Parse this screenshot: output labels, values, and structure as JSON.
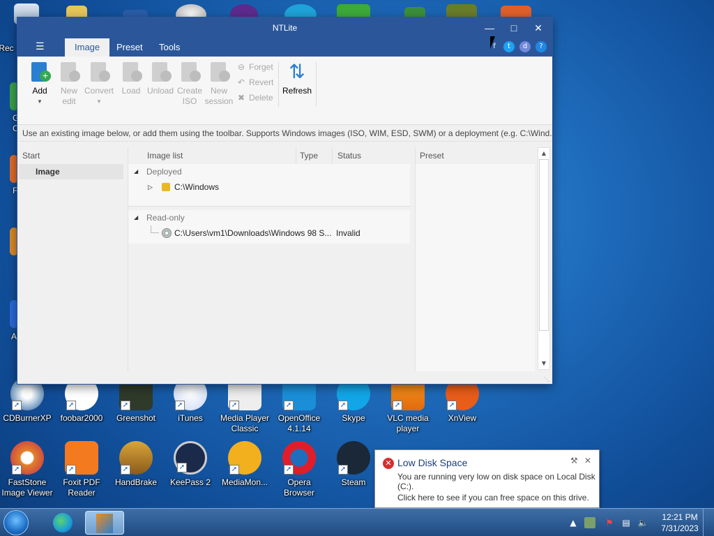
{
  "desktop": {
    "top_row_partial_labels": [
      "Rec"
    ],
    "left_partial_letters": [
      "G",
      "C",
      "F",
      "A"
    ],
    "icons_row1": [
      {
        "label": "CDBurnerXP",
        "icon": "cdburnerxp-icon"
      },
      {
        "label": "foobar2000",
        "icon": "foobar2000-icon"
      },
      {
        "label": "Greenshot",
        "icon": "greenshot-icon"
      },
      {
        "label": "iTunes",
        "icon": "itunes-icon"
      },
      {
        "label": "Media Player Classic",
        "icon": "media-player-classic-icon"
      },
      {
        "label": "OpenOffice 4.1.14",
        "icon": "openoffice-icon"
      },
      {
        "label": "Skype",
        "icon": "skype-icon"
      },
      {
        "label": "VLC media player",
        "icon": "vlc-icon"
      },
      {
        "label": "XnView",
        "icon": "xnview-icon"
      }
    ],
    "icons_row2": [
      {
        "label": "FastStone Image Viewer",
        "icon": "faststone-icon"
      },
      {
        "label": "Foxit PDF Reader",
        "icon": "foxit-icon"
      },
      {
        "label": "HandBrake",
        "icon": "handbrake-icon"
      },
      {
        "label": "KeePass 2",
        "icon": "keepass-icon"
      },
      {
        "label": "MediaMon...",
        "icon": "mediamonkey-icon"
      },
      {
        "label": "Opera Browser",
        "icon": "opera-icon"
      },
      {
        "label": "Steam",
        "icon": "steam-icon"
      }
    ]
  },
  "window": {
    "title": "NTLite",
    "tabs": [
      "Image",
      "Preset",
      "Tools"
    ],
    "active_tab": "Image",
    "ribbon": {
      "buttons": [
        {
          "label": "Add",
          "enabled": true,
          "icon": "add-image-icon"
        },
        {
          "label": "New edit",
          "enabled": false,
          "icon": "new-edit-icon"
        },
        {
          "label": "Convert",
          "enabled": false,
          "icon": "convert-icon"
        },
        {
          "label": "Load",
          "enabled": false,
          "icon": "load-icon"
        },
        {
          "label": "Unload",
          "enabled": false,
          "icon": "unload-icon"
        },
        {
          "label": "Create ISO",
          "enabled": false,
          "icon": "create-iso-icon"
        },
        {
          "label": "New session",
          "enabled": false,
          "icon": "new-session-icon"
        }
      ],
      "small_buttons": [
        {
          "label": "Forget",
          "icon": "forget-icon"
        },
        {
          "label": "Revert",
          "icon": "revert-icon"
        },
        {
          "label": "Delete",
          "icon": "delete-icon"
        }
      ],
      "refresh_label": "Refresh"
    },
    "info_text": "Use an existing image below, or add them using the toolbar. Supports Windows images (ISO, WIM, ESD, SWM) or a deployment (e.g. C:\\Wind...",
    "start_pane": {
      "header": "Start",
      "item": "Image"
    },
    "list": {
      "columns": [
        "Image list",
        "Type",
        "Status"
      ],
      "groups": [
        {
          "name": "Deployed",
          "rows": [
            {
              "path": "C:\\Windows",
              "type": "",
              "status": ""
            }
          ]
        },
        {
          "name": "Read-only",
          "rows": [
            {
              "path": "C:\\Users\\vm1\\Downloads\\Windows 98 S...",
              "type": "",
              "status": "Invalid"
            }
          ]
        }
      ]
    },
    "preset_pane": {
      "header": "Preset"
    }
  },
  "notification": {
    "title": "Low Disk Space",
    "line1": "You are running very low on disk space on Local Disk",
    "line2": "(C:).",
    "line3": "Click here to see if you can free space on this drive."
  },
  "taskbar": {
    "clock_time": "12:21 PM",
    "clock_date": "7/31/2023"
  },
  "colors": {
    "window_accent": "#2b579a",
    "desktop": "#1f6dbd",
    "error_red": "#d42f2f"
  }
}
